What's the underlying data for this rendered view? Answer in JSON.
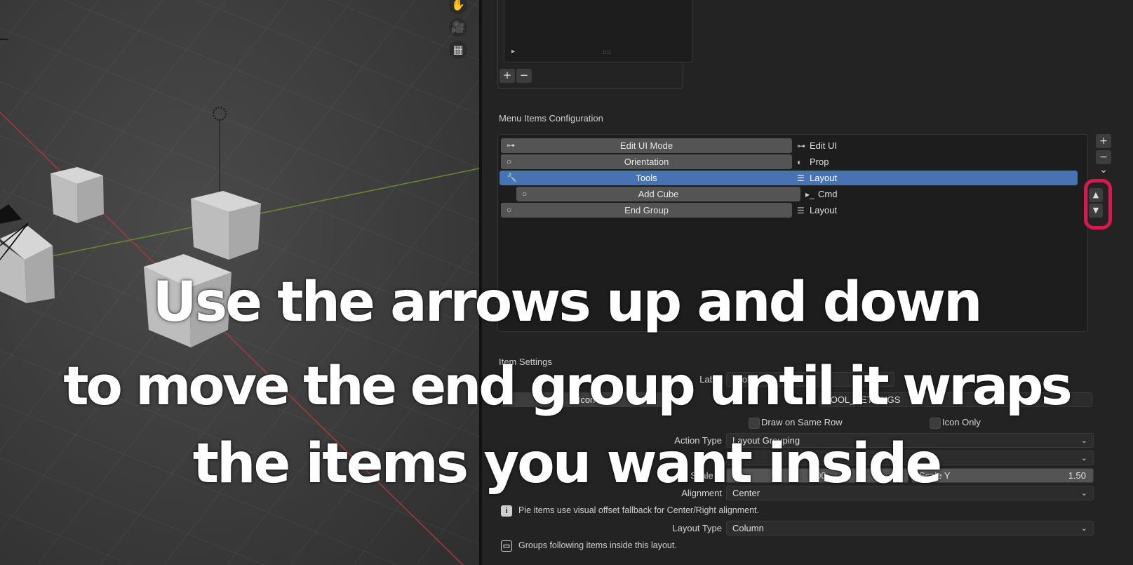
{
  "viewport": {
    "nav_icons": [
      {
        "name": "hand-icon",
        "glyph": "✋"
      },
      {
        "name": "camera-icon",
        "glyph": "🎥"
      },
      {
        "name": "grid-icon",
        "glyph": "▦"
      }
    ]
  },
  "top_list": {
    "play_glyph": "▸",
    "grip_glyph": "::::",
    "add_label": "+",
    "remove_label": "−"
  },
  "menu_items": {
    "title": "Menu Items Configuration",
    "rows": [
      {
        "label": "Edit UI Mode",
        "type": "Edit UI",
        "left_icon": "node-icon",
        "left_glyph": "⊶",
        "type_icon": "node-icon",
        "type_glyph": "⊶",
        "selected": false,
        "indent": false
      },
      {
        "label": "Orientation",
        "type": "Prop",
        "left_icon": "dot-icon",
        "left_glyph": "○",
        "type_icon": "toggle-icon",
        "type_glyph": "◐",
        "selected": false,
        "indent": false
      },
      {
        "label": "Tools",
        "type": "Layout",
        "left_icon": "tools-icon",
        "left_glyph": "🔧",
        "type_icon": "layout-icon",
        "type_glyph": "☰",
        "selected": true,
        "indent": false
      },
      {
        "label": "Add Cube",
        "type": "Cmd",
        "left_icon": "dot-icon",
        "left_glyph": "○",
        "type_icon": "console-icon",
        "type_glyph": "▸_",
        "selected": false,
        "indent": true
      },
      {
        "label": "End Group",
        "type": "Layout",
        "left_icon": "dot-icon",
        "left_glyph": "○",
        "type_icon": "layout-icon",
        "type_glyph": "☰",
        "selected": false,
        "indent": false
      }
    ],
    "side_buttons": {
      "add": "+",
      "remove": "−",
      "more": "⌄",
      "up": "▲",
      "down": "▼"
    }
  },
  "item_settings": {
    "title": "Item Settings",
    "label_label": "Label",
    "label_value": "Tools",
    "icon_button_label": "Icon",
    "icon_value": "TOOL_SETTINGS",
    "draw_same_row": "Draw on Same Row",
    "icon_only": "Icon Only",
    "action_type_label": "Action Type",
    "action_type_value": "Layout Grouping",
    "scale_x_label": "Scale X",
    "scale_x_value": "1.00",
    "scale_y_label": "Scale Y",
    "scale_y_value": "1.50",
    "alignment_label": "Alignment",
    "alignment_value": "Center",
    "pie_info": "Pie items use visual offset fallback for Center/Right alignment.",
    "layout_type_label": "Layout Type",
    "layout_type_value": "Column",
    "groups_info": "Groups following items inside this layout."
  },
  "caption": {
    "line1": "Use the arrows up and down",
    "line2": "to move the end group until it wraps",
    "line3": "the items you want inside"
  },
  "colors": {
    "selection": "#4772b3",
    "highlight_ring": "#d8184f",
    "panel_bg": "#232323"
  }
}
